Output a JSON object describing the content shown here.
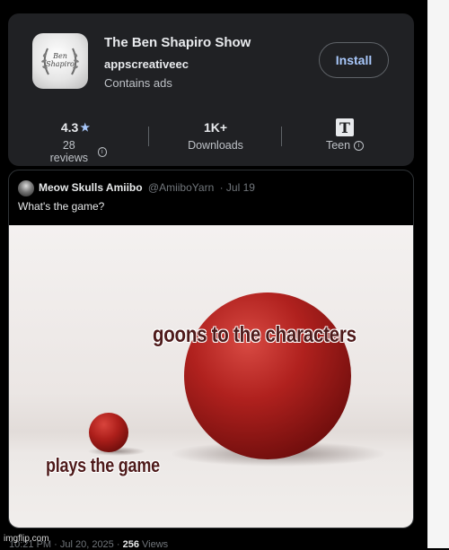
{
  "colors": {
    "background": "#000000",
    "card": "#202124",
    "accent_blue": "#a8c7fa",
    "ball_red": "#b0211e",
    "caption": "#4e1a1a"
  },
  "play_store": {
    "app_title": "The Ben Shapiro Show",
    "developer": "appscreativeec",
    "ads_notice": "Contains ads",
    "install_label": "Install",
    "icon_text_line1": "Ben",
    "icon_text_line2": "Shapiro",
    "stats": [
      {
        "value": "4.3",
        "suffix_icon": "star-icon",
        "label": "28 reviews"
      },
      {
        "value": "1K+",
        "label": "Downloads"
      },
      {
        "value_icon": "teen-rating-icon",
        "label": "Teen"
      }
    ]
  },
  "tweet": {
    "author": "Meow Skulls Amiibo",
    "handle": "@AmiiboYarn",
    "date": "· Jul 19",
    "text": "What's the game?",
    "meme_caption_top": "goons to the characters",
    "meme_caption_bottom": "plays the game",
    "footer": {
      "time": "10:21 PM · Jul 20, 2025 · ",
      "views_count": "256",
      "views_label": " Views"
    }
  },
  "watermark": "imgflip.com"
}
